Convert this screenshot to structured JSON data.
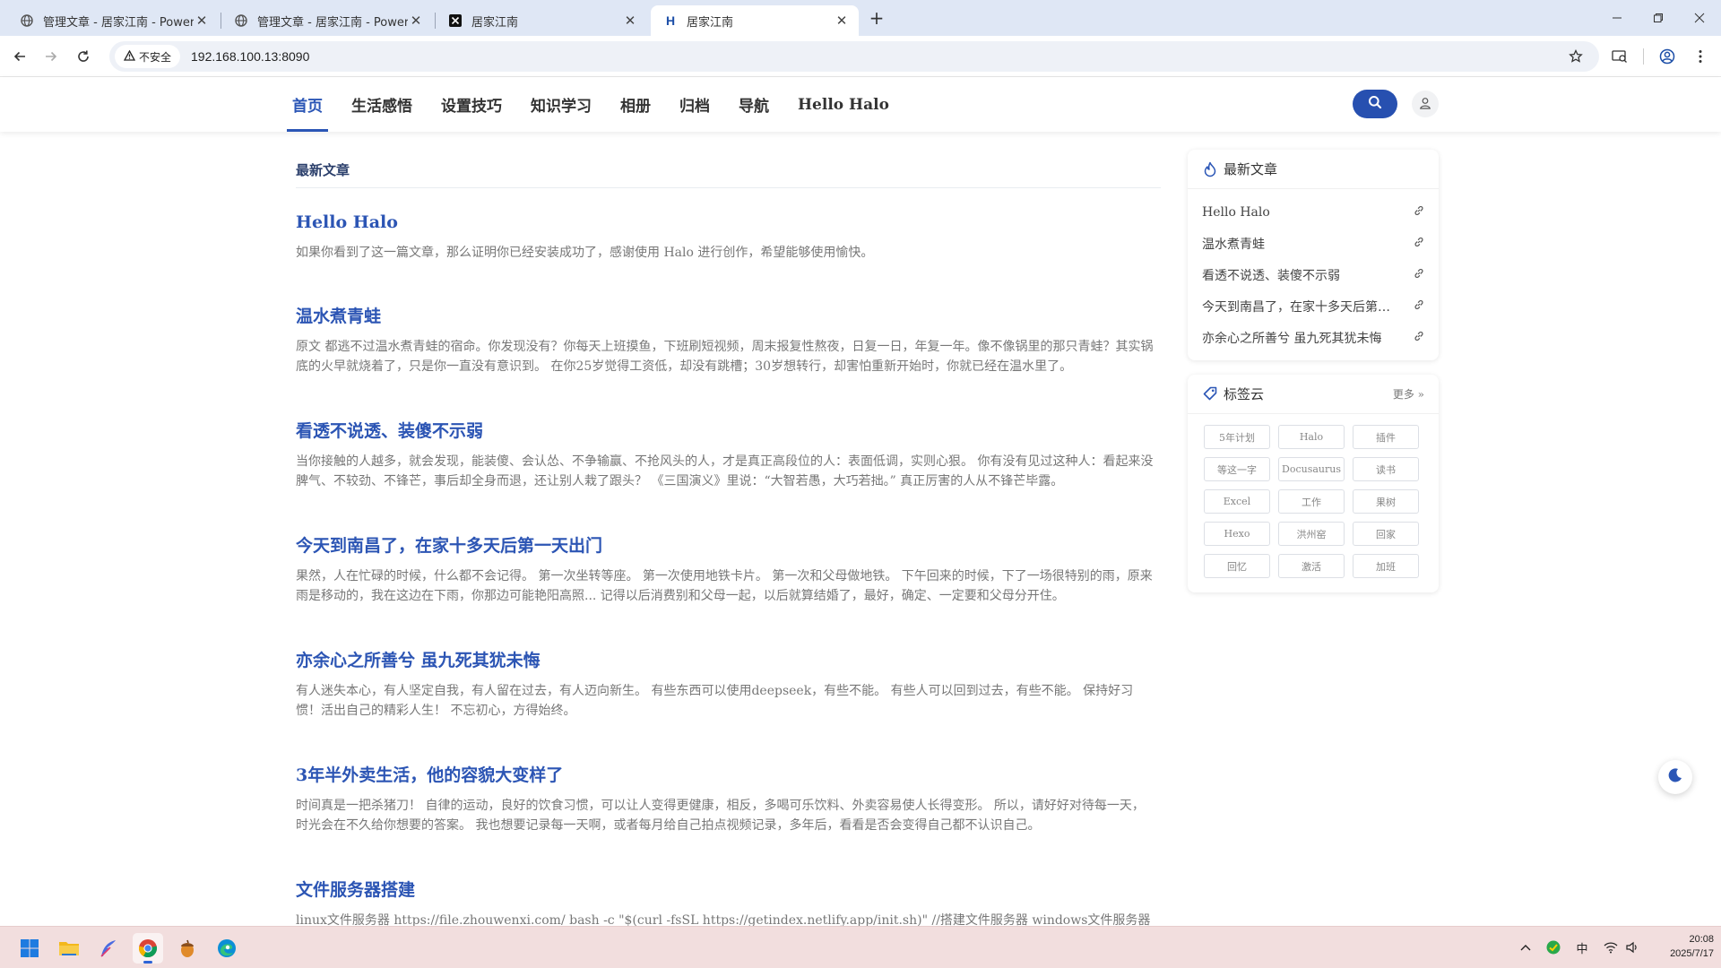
{
  "browser": {
    "tabs": [
      {
        "title": "管理文章 - 居家江南 - Powered by",
        "icon": "globe-icon",
        "active": false
      },
      {
        "title": "管理文章 - 居家江南 - Powered by",
        "icon": "globe-icon",
        "active": false
      },
      {
        "title": "居家江南",
        "icon": "x-logo-icon",
        "active": false
      },
      {
        "title": "居家江南",
        "icon": "halo-h-icon",
        "active": true
      }
    ],
    "security_label": "不安全",
    "url": "192.168.100.13:8090"
  },
  "site": {
    "menu": [
      "首页",
      "生活感悟",
      "设置技巧",
      "知识学习",
      "相册",
      "归档",
      "导航",
      "Hello Halo"
    ],
    "active_menu_index": 0,
    "accent_color": "#2b56b6"
  },
  "main": {
    "section_title": "最新文章",
    "posts": [
      {
        "title": "Hello Halo",
        "excerpt": "如果你看到了这一篇文章，那么证明你已经安装成功了，感谢使用 Halo 进行创作，希望能够使用愉快。"
      },
      {
        "title": "温水煮青蛙",
        "excerpt": "原文 都逃不过温水煮青蛙的宿命。你发现没有？你每天上班摸鱼，下班刷短视频，周末报复性熬夜，日复一日，年复一年。像不像锅里的那只青蛙？其实锅底的火早就烧着了，只是你一直没有意识到。 在你25岁觉得工资低，却没有跳槽；30岁想转行，却害怕重新开始时，你就已经在温水里了。"
      },
      {
        "title": "看透不说透、装傻不示弱",
        "excerpt": "当你接触的人越多，就会发现，能装傻、会认怂、不争输赢、不抢风头的人，才是真正高段位的人：表面低调，实则心狠。 你有没有见过这种人：看起来没脾气、不较劲、不锋芒，事后却全身而退，还让别人栽了跟头？ 《三国演义》里说：“大智若愚，大巧若拙。” 真正厉害的人从不锋芒毕露。"
      },
      {
        "title": "今天到南昌了，在家十多天后第一天出门",
        "excerpt": "果然，人在忙碌的时候，什么都不会记得。 第一次坐转等座。 第一次使用地铁卡片。 第一次和父母做地铁。 下午回来的时候，下了一场很特别的雨，原来雨是移动的，我在这边在下雨，你那边可能艳阳高照... 记得以后消费别和父母一起，以后就算结婚了，最好，确定、一定要和父母分开住。"
      },
      {
        "title": "亦余心之所善兮 虽九死其犹未悔",
        "excerpt": "有人迷失本心，有人坚定自我，有人留在过去，有人迈向新生。 有些东西可以使用deepseek，有些不能。 有些人可以回到过去，有些不能。 保持好习惯！活出自己的精彩人生！ 不忘初心，方得始终。"
      },
      {
        "title": "3年半外卖生活，他的容貌大变样了",
        "excerpt": "时间真是一把杀猪刀！ 自律的运动，良好的饮食习惯，可以让人变得更健康，相反，多喝可乐饮料、外卖容易使人长得变形。 所以，请好好对待每一天，时光会在不久给你想要的答案。 我也想要记录每一天啊，或者每月给自己拍点视频记录，多年后，看看是否会变得自己都不认识自己。"
      },
      {
        "title": "文件服务器搭建",
        "excerpt": "linux文件服务器 https://file.zhouwenxi.com/ bash -c \"$(curl -fsSL https://getindex.netlify.app/init.sh)\" //搭建文件服务器 windows文件服务器 不需要安装任何软件"
      }
    ]
  },
  "sidebar": {
    "recent": {
      "title": "最新文章",
      "items": [
        "Hello Halo",
        "温水煮青蛙",
        "看透不说透、装傻不示弱",
        "今天到南昌了，在家十多天后第一天出门",
        "亦余心之所善兮 虽九死其犹未悔"
      ]
    },
    "tags": {
      "title": "标签云",
      "more": "更多",
      "items": [
        "5年计划",
        "Halo",
        "插件",
        "等这一字",
        "Docusaurus",
        "读书",
        "Excel",
        "工作",
        "果树",
        "Hexo",
        "洪州窑",
        "回家",
        "回忆",
        "激活",
        "加班"
      ]
    }
  },
  "taskbar": {
    "apps": [
      "windows-start-icon",
      "file-explorer-icon",
      "feather-app-icon",
      "chrome-icon",
      "acorn-app-icon",
      "edge-icon"
    ],
    "ime": "中",
    "time": "20:08",
    "date": "2025/7/17"
  }
}
